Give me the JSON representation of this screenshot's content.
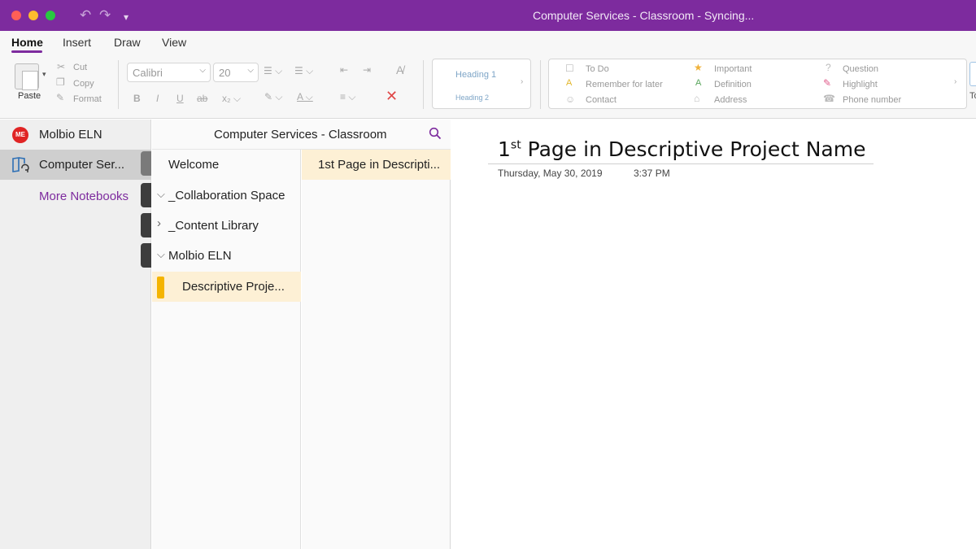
{
  "window": {
    "title": "Computer Services - Classroom - Syncing..."
  },
  "ribbon_tabs": [
    "Home",
    "Insert",
    "Draw",
    "View"
  ],
  "ribbon": {
    "paste_label": "Paste",
    "cut_label": "Cut",
    "copy_label": "Copy",
    "format_label": "Format",
    "font_name": "Calibri",
    "font_size": "20",
    "heading1_label": "Heading 1",
    "heading2_label": "Heading 2",
    "tags": {
      "todo": "To Do",
      "remember": "Remember for later",
      "contact": "Contact",
      "important": "Important",
      "definition": "Definition",
      "address": "Address",
      "question": "Question",
      "highlight": "Highlight",
      "phone": "Phone number"
    },
    "partial_label": "To"
  },
  "notebooks": {
    "items": [
      {
        "label": "Molbio ELN",
        "avatar": "ME"
      },
      {
        "label": "Computer Ser..."
      }
    ],
    "more_label": "More Notebooks"
  },
  "sections": {
    "header": "Computer Services - Classroom",
    "items": [
      {
        "label": "Welcome"
      },
      {
        "label": "_Collaboration Space"
      },
      {
        "label": "_Content Library"
      },
      {
        "label": "Molbio ELN"
      },
      {
        "label": "Descriptive Proje..."
      }
    ]
  },
  "pages": {
    "items": [
      {
        "label": "1st Page in Descripti..."
      }
    ]
  },
  "page": {
    "title_prefix": "1",
    "title_sup": "st",
    "title_rest": " Page in Descriptive Project Name",
    "date": "Thursday, May 30, 2019",
    "time": "3:37 PM"
  },
  "colors": {
    "brand": "#7d2b9e",
    "selected_section": "#fdf0d5",
    "section_tab": "#f4b400"
  }
}
